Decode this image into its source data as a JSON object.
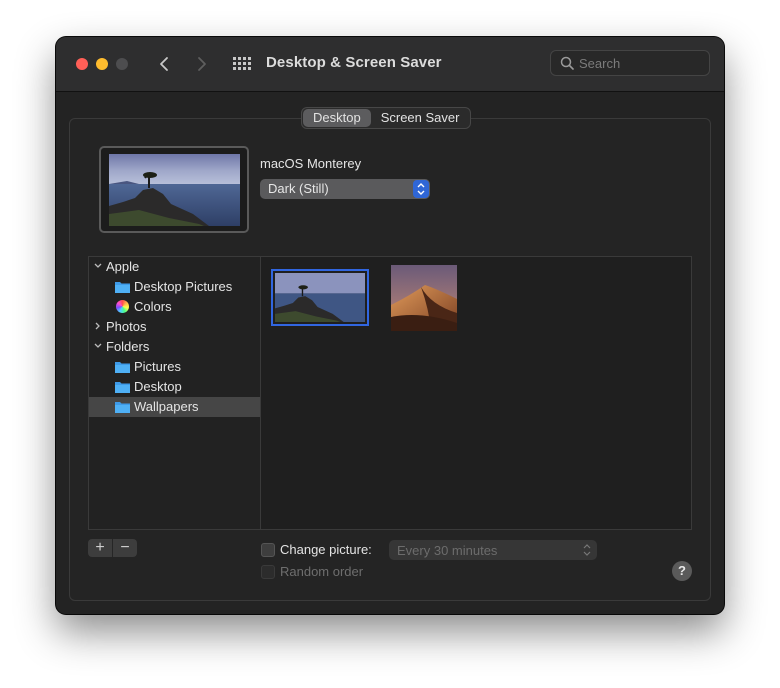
{
  "window": {
    "title": "Desktop & Screen Saver"
  },
  "search": {
    "placeholder": "Search"
  },
  "tabs": [
    {
      "label": "Desktop",
      "active": true
    },
    {
      "label": "Screen Saver",
      "active": false
    }
  ],
  "current_wallpaper": {
    "name": "macOS Monterey",
    "appearance_popup": "Dark (Still)"
  },
  "sidebar": {
    "items": [
      {
        "label": "Apple",
        "expanded": true
      },
      {
        "label": "Desktop Pictures"
      },
      {
        "label": "Colors"
      },
      {
        "label": "Photos",
        "expanded": false
      },
      {
        "label": "Folders",
        "expanded": true
      },
      {
        "label": "Pictures"
      },
      {
        "label": "Desktop"
      },
      {
        "label": "Wallpapers",
        "selected": true
      }
    ]
  },
  "buttons": {
    "add": "+",
    "remove": "−",
    "help": "?"
  },
  "options": {
    "change_picture": "Change picture:",
    "interval": "Every 30 minutes",
    "random_order": "Random order"
  },
  "colors": {
    "accent": "#3166e0",
    "window_bg": "#232323",
    "selection": "#464646"
  }
}
